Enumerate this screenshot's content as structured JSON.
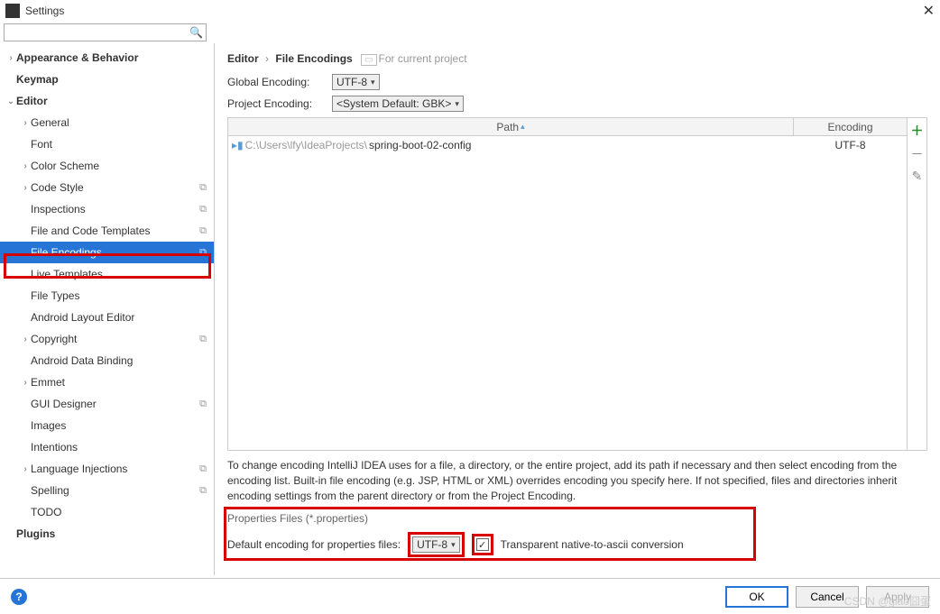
{
  "window": {
    "title": "Settings"
  },
  "breadcrumb": {
    "a": "Editor",
    "b": "File Encodings",
    "hint": "For current project"
  },
  "global_encoding": {
    "label": "Global Encoding:",
    "value": "UTF-8"
  },
  "project_encoding": {
    "label": "Project Encoding:",
    "value": "<System Default: GBK>"
  },
  "table": {
    "col_path": "Path",
    "col_enc": "Encoding",
    "row_prefix": "C:\\Users\\lfy\\IdeaProjects\\",
    "row_project": "spring-boot-02-config",
    "row_enc": "UTF-8"
  },
  "help": "To change encoding IntelliJ IDEA uses for a file, a directory, or the entire project, add its path if necessary and then select encoding from the encoding list. Built-in file encoding (e.g. JSP, HTML or XML) overrides encoding you specify here. If not specified, files and directories inherit encoding settings from the parent directory or from the Project Encoding.",
  "props": {
    "title": "Properties Files (*.properties)",
    "label": "Default encoding for properties files:",
    "value": "UTF-8",
    "checkbox_label": "Transparent native-to-ascii conversion"
  },
  "buttons": {
    "ok": "OK",
    "cancel": "Cancel",
    "apply": "Apply"
  },
  "watermark": "CSDN @giao囧蛋",
  "sidebar": [
    {
      "lvl": 0,
      "label": "Appearance & Behavior",
      "bold": true,
      "arrow": "›"
    },
    {
      "lvl": 0,
      "label": "Keymap",
      "bold": true
    },
    {
      "lvl": 0,
      "label": "Editor",
      "bold": true,
      "arrow": "⌄"
    },
    {
      "lvl": 1,
      "label": "General",
      "arrow": "›"
    },
    {
      "lvl": 1,
      "label": "Font"
    },
    {
      "lvl": 1,
      "label": "Color Scheme",
      "arrow": "›"
    },
    {
      "lvl": 1,
      "label": "Code Style",
      "arrow": "›",
      "badge": "⧉"
    },
    {
      "lvl": 1,
      "label": "Inspections",
      "badge": "⧉"
    },
    {
      "lvl": 1,
      "label": "File and Code Templates",
      "badge": "⧉"
    },
    {
      "lvl": 1,
      "label": "File Encodings",
      "badge": "⧉",
      "selected": true
    },
    {
      "lvl": 1,
      "label": "Live Templates"
    },
    {
      "lvl": 1,
      "label": "File Types"
    },
    {
      "lvl": 1,
      "label": "Android Layout Editor"
    },
    {
      "lvl": 1,
      "label": "Copyright",
      "arrow": "›",
      "badge": "⧉"
    },
    {
      "lvl": 1,
      "label": "Android Data Binding"
    },
    {
      "lvl": 1,
      "label": "Emmet",
      "arrow": "›"
    },
    {
      "lvl": 1,
      "label": "GUI Designer",
      "badge": "⧉"
    },
    {
      "lvl": 1,
      "label": "Images"
    },
    {
      "lvl": 1,
      "label": "Intentions"
    },
    {
      "lvl": 1,
      "label": "Language Injections",
      "arrow": "›",
      "badge": "⧉"
    },
    {
      "lvl": 1,
      "label": "Spelling",
      "badge": "⧉"
    },
    {
      "lvl": 1,
      "label": "TODO"
    },
    {
      "lvl": 0,
      "label": "Plugins",
      "bold": true
    }
  ]
}
